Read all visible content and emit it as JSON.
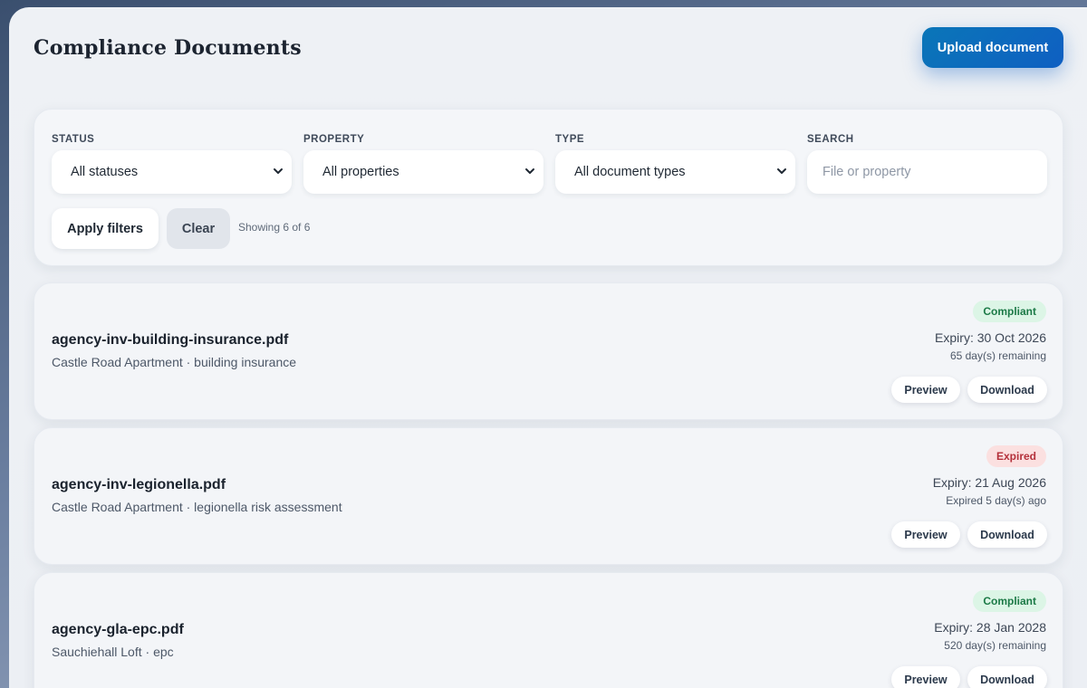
{
  "page": {
    "title": "Compliance Documents",
    "upload_label": "Upload document"
  },
  "filters": {
    "status": {
      "label": "STATUS",
      "value": "All statuses"
    },
    "property": {
      "label": "PROPERTY",
      "value": "All properties"
    },
    "type": {
      "label": "TYPE",
      "value": "All document types"
    },
    "search": {
      "label": "SEARCH",
      "placeholder": "File or property",
      "value": ""
    },
    "apply_label": "Apply filters",
    "clear_label": "Clear",
    "showing_text": "Showing 6 of 6"
  },
  "documents": [
    {
      "name": "agency-inv-building-insurance.pdf",
      "meta": "Castle Road Apartment · building insurance",
      "status": "Compliant",
      "expiry": "Expiry: 30 Oct 2026",
      "remaining": "65 day(s) remaining",
      "preview_label": "Preview",
      "download_label": "Download"
    },
    {
      "name": "agency-inv-legionella.pdf",
      "meta": "Castle Road Apartment · legionella risk assessment",
      "status": "Expired",
      "expiry": "Expiry: 21 Aug 2026",
      "remaining": "Expired 5 day(s) ago",
      "preview_label": "Preview",
      "download_label": "Download"
    },
    {
      "name": "agency-gla-epc.pdf",
      "meta": "Sauchiehall Loft · epc",
      "status": "Compliant",
      "expiry": "Expiry: 28 Jan 2028",
      "remaining": "520 day(s) remaining",
      "preview_label": "Preview",
      "download_label": "Download"
    }
  ],
  "colors": {
    "accent": "#0f5fc2",
    "compliant_bg": "#dcf5e6",
    "compliant_text": "#1c7a47",
    "expired_bg": "#fbe0e0",
    "expired_text": "#b4303a"
  },
  "icons": {
    "select_chevron": "chevron-down-icon"
  }
}
